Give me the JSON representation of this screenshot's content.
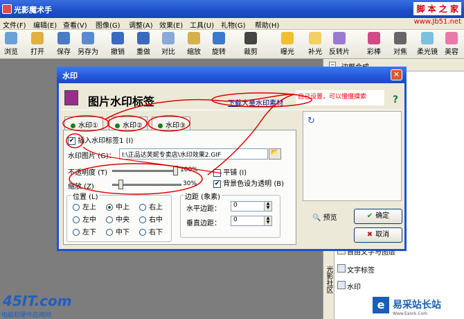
{
  "app": {
    "title": "光影魔术手",
    "watermark_top": "脚 本 之 家",
    "watermark_url": "www.Jb51.net"
  },
  "menu": [
    "文件(F)",
    "编辑(E)",
    "查看(V)",
    "图像(G)",
    "调整(A)",
    "效果(E)",
    "工具(U)",
    "礼物(G)",
    "帮助(H)"
  ],
  "toolbar": [
    {
      "label": "浏览",
      "icon": "browse-icon",
      "color": "#6aa0d8"
    },
    {
      "label": "打开",
      "icon": "open-icon",
      "color": "#e0b040"
    },
    {
      "label": "保存",
      "icon": "save-icon",
      "color": "#4a7bc4"
    },
    {
      "label": "另存为",
      "icon": "save-as-icon",
      "color": "#5a8ad4"
    },
    {
      "label": "撤销",
      "icon": "undo-icon",
      "color": "#3a6ac0"
    },
    {
      "label": "重做",
      "icon": "redo-icon",
      "color": "#3a6ac0"
    },
    {
      "label": "对比",
      "icon": "compare-icon",
      "color": "#8aa8d8"
    },
    {
      "label": "缩放",
      "icon": "zoom-icon",
      "color": "#d6b14a"
    },
    {
      "label": "旋转",
      "icon": "rotate-icon",
      "color": "#3a7ac8"
    },
    {
      "label": "裁剪",
      "icon": "crop-icon",
      "color": "#444444"
    },
    {
      "label": "曝光",
      "icon": "exposure-icon",
      "color": "#f0c030"
    },
    {
      "label": "补光",
      "icon": "fill-light-icon",
      "color": "#f4d060"
    },
    {
      "label": "反转片",
      "icon": "reversal-icon",
      "color": "#9a7ad0"
    },
    {
      "label": "彩棒",
      "icon": "color-wand-icon",
      "color": "#d04a8a"
    },
    {
      "label": "对焦",
      "icon": "focus-icon",
      "color": "#666666"
    },
    {
      "label": "柔光镜",
      "icon": "soft-light-icon",
      "color": "#7ac0e0"
    },
    {
      "label": "美容",
      "icon": "beauty-icon",
      "color": "#e87aa8"
    }
  ],
  "right_panel": {
    "header": "边框合成",
    "vtab": "光影社区",
    "items": [
      {
        "label": "自由文字与图层",
        "icon": "text-layer-icon"
      },
      {
        "label": "文字标签",
        "icon": "text-label-icon"
      },
      {
        "label": "水印",
        "icon": "watermark-icon"
      }
    ]
  },
  "dialog": {
    "title": "水印",
    "header": "图片水印标签",
    "download_link": "下载大量水印素材",
    "note": "自己设置，可以慢慢摸索",
    "tabs": [
      "水印①",
      "水印②",
      "水印③"
    ],
    "insert_label": "插入水印标签1 (I)",
    "image_label": "水印图片 (G)：",
    "image_path": "I:\\正品达芙妮专卖店\\水印效果2.GIF",
    "opacity_label": "不透明度 (T)",
    "opacity_value": "100%",
    "opacity_level": 1.0,
    "scale_label": "缩放 (Z)",
    "scale_value": "30%",
    "scale_level": 0.3,
    "tile_label": "平铺 (I)",
    "transparent_label": "背景色设为透明 (B)",
    "position": {
      "legend": "位置 (L)",
      "options": [
        "左上",
        "中上",
        "右上",
        "左中",
        "中央",
        "右中",
        "左下",
        "中下",
        "右下"
      ],
      "selected": 1
    },
    "margin": {
      "legend": "边距 (象素)",
      "h_label": "水平边距：",
      "h_value": "0",
      "v_label": "垂直边距：",
      "v_value": "0"
    },
    "preview": "预览",
    "ok": "确定",
    "cancel": "取消"
  },
  "logos": {
    "left_big": "45IT.com",
    "left_small": "电脑软硬件应用网",
    "right": "易采站长站",
    "right_url": "Www.Easck.Com"
  },
  "colors": {
    "titlebar": "#1c4fc8",
    "annotation": "#e00000"
  }
}
